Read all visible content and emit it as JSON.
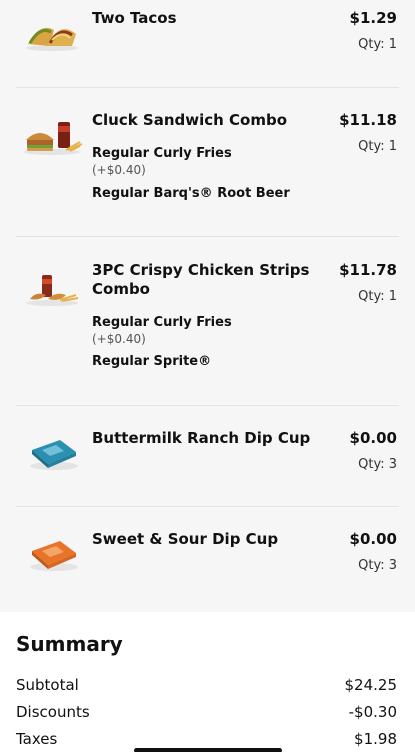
{
  "items": [
    {
      "name": "Two Tacos",
      "price": "$1.29",
      "qty": "Qty: 1",
      "image_icon": "tacos-icon",
      "modifiers": []
    },
    {
      "name": "Cluck Sandwich Combo",
      "price": "$11.18",
      "qty": "Qty: 1",
      "image_icon": "sandwich-combo-icon",
      "modifiers": [
        {
          "label": "Regular Curly Fries",
          "price": "(+$0.40)"
        },
        {
          "label": "Regular Barq's® Root Beer",
          "price": ""
        }
      ]
    },
    {
      "name_line1": "3PC Crispy Chicken Strips",
      "name_line2": "Combo",
      "price": "$11.78",
      "qty": "Qty: 1",
      "image_icon": "chicken-strips-combo-icon",
      "modifiers": [
        {
          "label": "Regular Curly Fries",
          "price": "(+$0.40)"
        },
        {
          "label": "Regular Sprite®",
          "price": ""
        }
      ]
    },
    {
      "name": "Buttermilk Ranch Dip Cup",
      "price": "$0.00",
      "qty": "Qty: 3",
      "image_icon": "ranch-dip-cup-icon",
      "modifiers": []
    },
    {
      "name": "Sweet & Sour Dip Cup",
      "price": "$0.00",
      "qty": "Qty: 3",
      "image_icon": "sweet-sour-dip-cup-icon",
      "modifiers": []
    }
  ],
  "summary": {
    "title": "Summary",
    "rows": [
      {
        "label": "Subtotal",
        "value": "$24.25"
      },
      {
        "label": "Discounts",
        "value": "-$0.30"
      },
      {
        "label": "Taxes",
        "value": "$1.98"
      }
    ]
  },
  "colors": {
    "background": "#f6f6f6",
    "summary_background": "#ffffff",
    "ranch_cup": "#2a8fb0",
    "sweet_sour_cup": "#e8742a"
  }
}
